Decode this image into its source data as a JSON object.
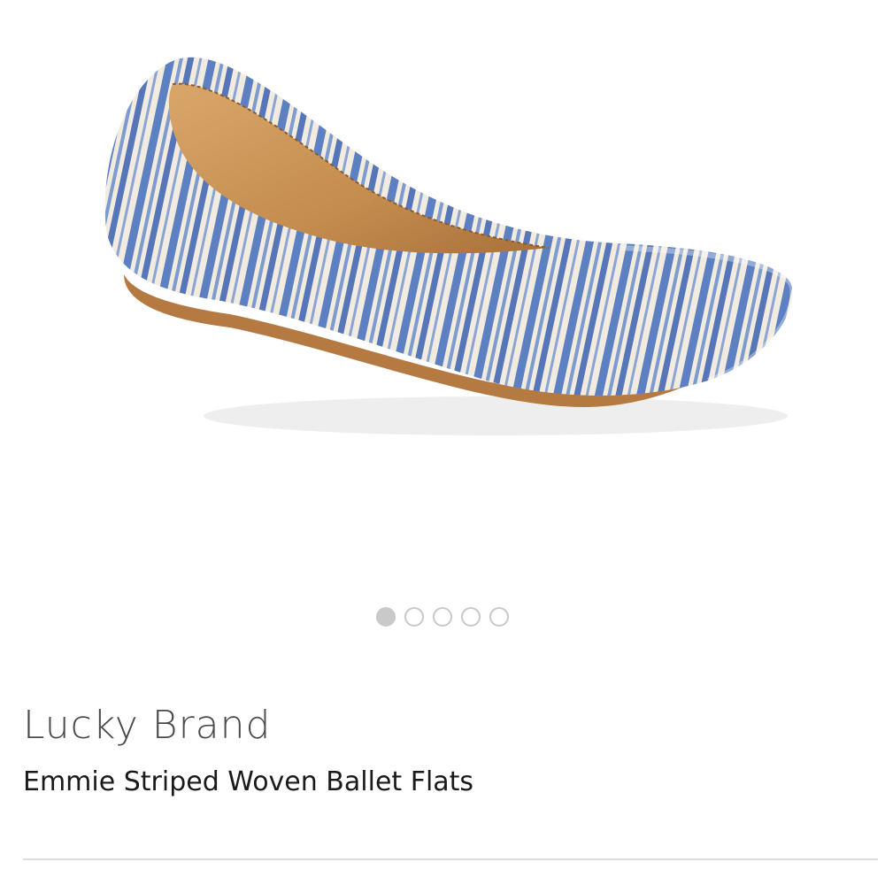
{
  "product": {
    "brand": "Lucky Brand",
    "title": "Emmie Striped Woven Ballet Flats",
    "image_icon": "ballet-flat-image"
  },
  "carousel": {
    "count": 5,
    "active_index": 0
  },
  "colors": {
    "stripe_blue": "#5d80c2",
    "fabric_cream": "#f1ecdf",
    "lining_tan": "#c48c4e",
    "sole_tan": "#b57a42",
    "dot": "#c9c9c9"
  }
}
